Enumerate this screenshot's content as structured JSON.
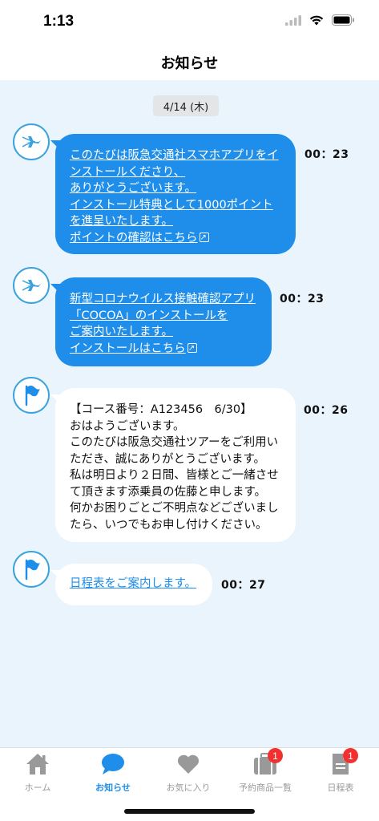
{
  "status_bar": {
    "time": "1:13"
  },
  "nav": {
    "title": "お知らせ"
  },
  "date_label": "4/14 (木)",
  "messages": [
    {
      "avatar": "airplane-icon",
      "style": "blue",
      "lines": [
        "このたびは阪急交通社スマホアプリをイ",
        "ンストールくださり、",
        "ありがとうございます。",
        "インストール特典として1000ポイント",
        "を進呈いたします。"
      ],
      "link_label": "ポイントの確認はこちら",
      "time": "00：23"
    },
    {
      "avatar": "airplane-icon",
      "style": "blue",
      "lines": [
        "新型コロナウイルス接触確認アプリ",
        "「COCOA」のインストールを",
        "ご案内いたします。"
      ],
      "link_label": "インストールはこちら",
      "time": "00：23"
    },
    {
      "avatar": "flag-icon",
      "style": "white",
      "lines": [
        "【コース番号：A123456　6/30】",
        "おはようございます。",
        "このたびは阪急交通社ツアーをご利用い",
        "ただき、誠にありがとうございます。",
        "私は明日より２日間、皆様とご一緒させ",
        "て頂きます添乗員の佐藤と申します。",
        "何かお困りごとご不明点などございまし",
        "たら、いつでもお申し付けください。"
      ],
      "time": "00：26"
    },
    {
      "avatar": "flag-icon",
      "style": "white",
      "link_label": "日程表をご案内します。",
      "time": "00：27"
    }
  ],
  "tabs": [
    {
      "label": "ホーム",
      "icon": "home-icon"
    },
    {
      "label": "お知らせ",
      "icon": "chat-bubble-icon",
      "active": true
    },
    {
      "label": "お気に入り",
      "icon": "heart-icon"
    },
    {
      "label": "予約商品一覧",
      "icon": "suitcase-icon",
      "badge": "1"
    },
    {
      "label": "日程表",
      "icon": "document-icon",
      "badge": "1"
    }
  ],
  "colors": {
    "accent": "#1e8eea",
    "background": "#eaf4fc",
    "badge": "#f23030"
  }
}
